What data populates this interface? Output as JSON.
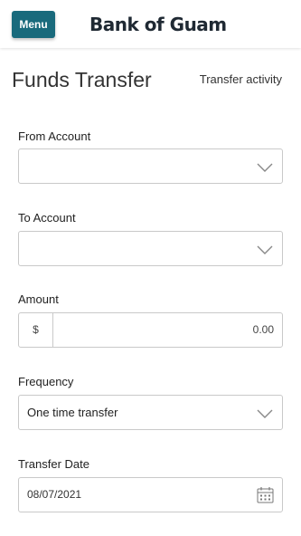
{
  "header": {
    "menu_label": "Menu",
    "logo_text": "Bank of Guam"
  },
  "page": {
    "title": "Funds Transfer",
    "activity_link": "Transfer activity"
  },
  "form": {
    "from_account": {
      "label": "From Account",
      "value": ""
    },
    "to_account": {
      "label": "To Account",
      "value": ""
    },
    "amount": {
      "label": "Amount",
      "prefix": "$",
      "value": "0.00"
    },
    "frequency": {
      "label": "Frequency",
      "value": "One time transfer"
    },
    "transfer_date": {
      "label": "Transfer Date",
      "value": "08/07/2021"
    }
  },
  "icons": {
    "dropdown": "chevron-down-icon",
    "calendar": "calendar-icon"
  },
  "colors": {
    "menu_button": "#196a7c",
    "border": "#c9c9c9"
  }
}
